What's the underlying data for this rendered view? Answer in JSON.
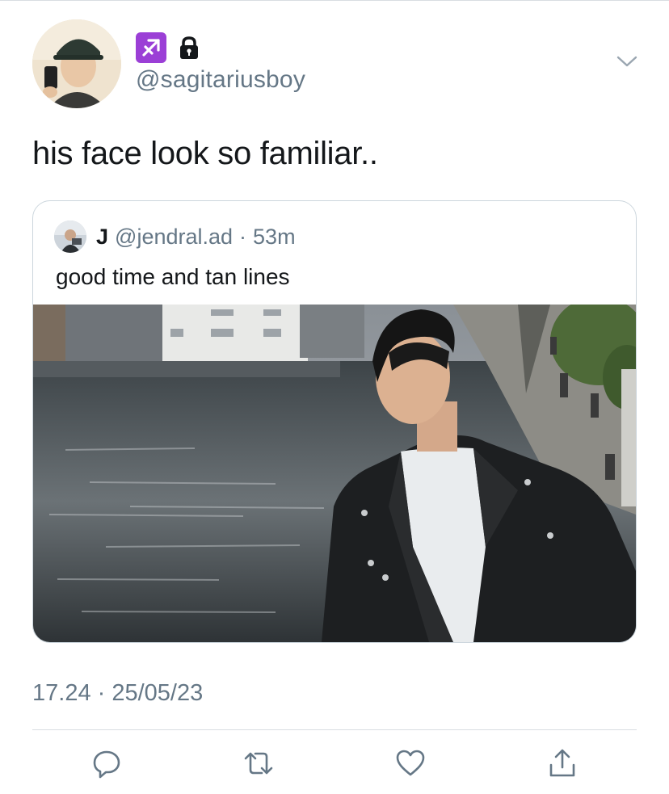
{
  "tweet": {
    "author": {
      "handle": "@sagitariusboy",
      "avatar_icon": "user-avatar",
      "badges": [
        "sagittarius-icon",
        "lock-icon"
      ],
      "zodiac_color": "#9b3fd6"
    },
    "text": "his face look so familiar..",
    "timestamp": "17.24 · 25/05/23"
  },
  "quoted": {
    "name": "J",
    "handle": "@jendral.ad",
    "separator": "·",
    "time": "53m",
    "text": "good time and tan lines",
    "photo_icon": "photo"
  },
  "actions": [
    "reply-icon",
    "retweet-icon",
    "like-icon",
    "share-icon"
  ],
  "colors": {
    "text": "#14171a",
    "secondary": "#657786",
    "border": "#ccd6dd",
    "accent": "#1da1f2"
  }
}
